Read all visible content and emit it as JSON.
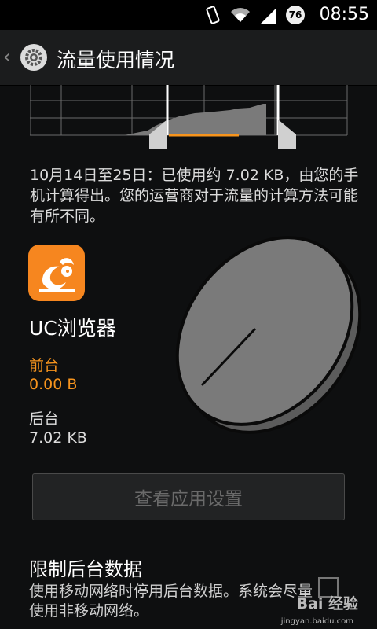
{
  "status_bar": {
    "time": "08:55",
    "battery": "76"
  },
  "action_bar": {
    "title": "流量使用情况"
  },
  "usage_summary": "10月14日至25日：已使用约 7.02 KB，由您的手机计算得出。您的运营商对于流量的计算方法可能有所不同。",
  "app": {
    "name": "UC浏览器",
    "foreground_label": "前台",
    "foreground_value": "0.00 B",
    "background_label": "后台",
    "background_value": "7.02 KB"
  },
  "app_settings_button": "查看应用设置",
  "restrict": {
    "title": "限制后台数据",
    "description": "使用移动网络时停用后台数据。系统会尽量使用非移动网络。"
  },
  "watermark": {
    "main": "Bai 经验",
    "sub": "jingyan.baidu.com"
  },
  "colors": {
    "accent": "#f7941d",
    "uc_orange": "#f6861f"
  }
}
